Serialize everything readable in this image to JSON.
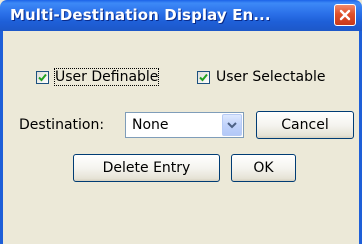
{
  "window": {
    "title": "Multi-Destination Display En...",
    "close_icon": "close-x-icon"
  },
  "options": {
    "user_definable": {
      "label": "User Definable",
      "checked": true
    },
    "user_selectable": {
      "label": "User Selectable",
      "checked": true
    }
  },
  "destination": {
    "label": "Destination:",
    "value": "None",
    "dropdown_icon": "chevron-down-icon"
  },
  "buttons": {
    "cancel": "Cancel",
    "delete_entry": "Delete Entry",
    "ok": "OK"
  },
  "colors": {
    "titlebar": "#1e5fd8",
    "close_button": "#d7481f",
    "dialog_background": "#ece9d8",
    "checkmark": "#21a121"
  }
}
